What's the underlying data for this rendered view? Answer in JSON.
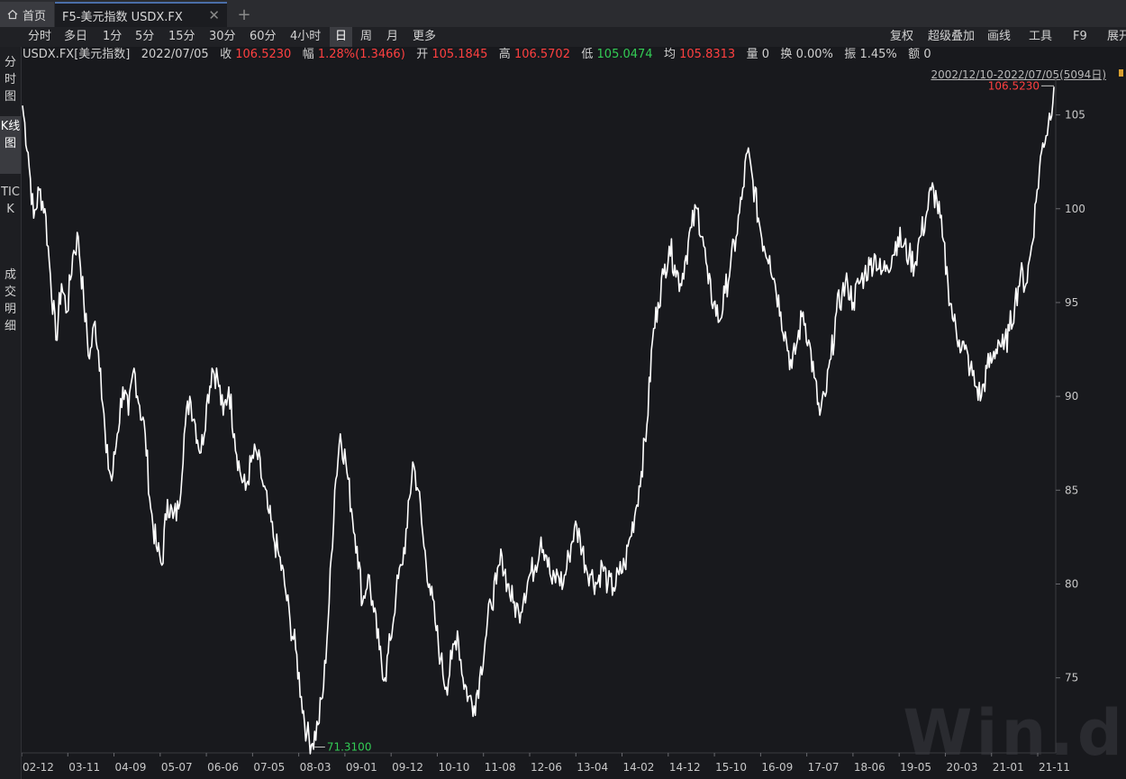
{
  "tabs": {
    "home_label": "首页",
    "active_label": "F5-美元指数 USDX.FX",
    "close_glyph": "✕",
    "add_glyph": "+"
  },
  "toolbar": {
    "periods": [
      "分时",
      "多日",
      "1分",
      "5分",
      "15分",
      "30分",
      "60分",
      "4小时",
      "日",
      "周",
      "月",
      "更多"
    ],
    "active_period": "日",
    "right_tools": [
      "复权",
      "超级叠加",
      "画线",
      "工具",
      "F9",
      "展开"
    ]
  },
  "sidebar": {
    "tabs": [
      "分时图",
      "K线图",
      "TICK",
      "成交明细"
    ],
    "active": "K线图"
  },
  "info": {
    "symbol": "USDX.FX[美元指数]",
    "date": "2022/07/05",
    "close_label": "收",
    "close_value": "106.5230",
    "change_label": "幅",
    "change_value": "1.28%(1.3466)",
    "open_label": "开",
    "open_value": "105.1845",
    "high_label": "高",
    "high_value": "106.5702",
    "low_label": "低",
    "low_value": "105.0474",
    "avg_label": "均",
    "avg_value": "105.8313",
    "vol_label": "量",
    "vol_value": "0",
    "turnover_label": "换",
    "turnover_value": "0.00%",
    "amplitude_label": "振",
    "amplitude_value": "1.45%",
    "amount_label": "额",
    "amount_value": "0",
    "range": "2002/12/10-2022/07/05(5094日)"
  },
  "colors": {
    "up": "#ff4040",
    "down": "#33cc55",
    "line": "#ffffff",
    "background": "#18191d"
  },
  "chart_data": {
    "type": "line",
    "title": "",
    "xlabel": "",
    "ylabel": "",
    "ylim": [
      71,
      106.9
    ],
    "y_ticks": [
      75,
      80,
      85,
      90,
      95,
      100,
      105
    ],
    "x_tick_labels": [
      "02-12",
      "03-11",
      "04-09",
      "05-07",
      "06-06",
      "07-05",
      "08-03",
      "09-01",
      "09-12",
      "10-10",
      "11-08",
      "12-06",
      "13-04",
      "14-02",
      "14-12",
      "15-10",
      "16-09",
      "17-07",
      "18-06",
      "19-05",
      "20-03",
      "21-01",
      "21-11"
    ],
    "max_label": "106.5230",
    "min_label": "71.3100",
    "series": [
      {
        "values": [
          105.5,
          103.0,
          99.5,
          101.0,
          100.0,
          96.5,
          93.0,
          96.0,
          94.5,
          97.5,
          98.5,
          95.0,
          92.0,
          94.0,
          91.5,
          87.0,
          85.5,
          88.0,
          90.5,
          89.0,
          91.5,
          89.5,
          88.0,
          84.0,
          82.0,
          81.0,
          84.5,
          83.5,
          84.0,
          88.0,
          90.0,
          88.5,
          87.0,
          89.5,
          91.5,
          91.0,
          89.0,
          90.5,
          88.0,
          86.0,
          85.0,
          86.5,
          87.0,
          85.5,
          84.0,
          82.5,
          81.5,
          80.0,
          78.0,
          76.5,
          74.0,
          72.0,
          71.5,
          72.5,
          74.5,
          79.0,
          85.0,
          88.0,
          86.5,
          84.0,
          82.0,
          79.0,
          80.5,
          78.5,
          76.5,
          75.0,
          77.0,
          79.5,
          81.0,
          83.0,
          86.5,
          85.0,
          82.0,
          80.0,
          78.0,
          76.0,
          74.5,
          76.0,
          77.5,
          75.0,
          74.0,
          73.5,
          75.0,
          77.0,
          79.0,
          80.0,
          81.5,
          80.0,
          79.0,
          78.5,
          79.5,
          80.5,
          81.0,
          82.5,
          81.5,
          80.0,
          80.5,
          80.0,
          81.5,
          83.0,
          82.5,
          81.0,
          80.5,
          80.0,
          81.0,
          80.0,
          79.8,
          80.5,
          81.0,
          82.5,
          84.0,
          86.0,
          88.5,
          93.0,
          95.0,
          96.5,
          98.0,
          97.0,
          96.0,
          97.5,
          99.0,
          100.0,
          98.5,
          96.0,
          95.0,
          94.0,
          95.5,
          97.0,
          98.5,
          100.5,
          103.0,
          101.5,
          99.5,
          98.0,
          97.5,
          96.0,
          94.5,
          93.0,
          91.5,
          93.0,
          94.5,
          93.0,
          91.0,
          89.0,
          90.0,
          92.0,
          94.5,
          95.5,
          96.0,
          95.0,
          96.0,
          96.5,
          97.0,
          97.5,
          96.5,
          97.0,
          97.5,
          98.5,
          98.0,
          97.5,
          97.0,
          98.5,
          99.5,
          101.0,
          100.5,
          98.5,
          96.0,
          94.0,
          93.0,
          92.5,
          91.5,
          90.5,
          90.0,
          91.5,
          92.0,
          93.0,
          92.5,
          93.5,
          95.0,
          96.5,
          96.0,
          98.0,
          101.0,
          103.5,
          104.5,
          106.5
        ]
      }
    ]
  },
  "watermark": "Win.d"
}
